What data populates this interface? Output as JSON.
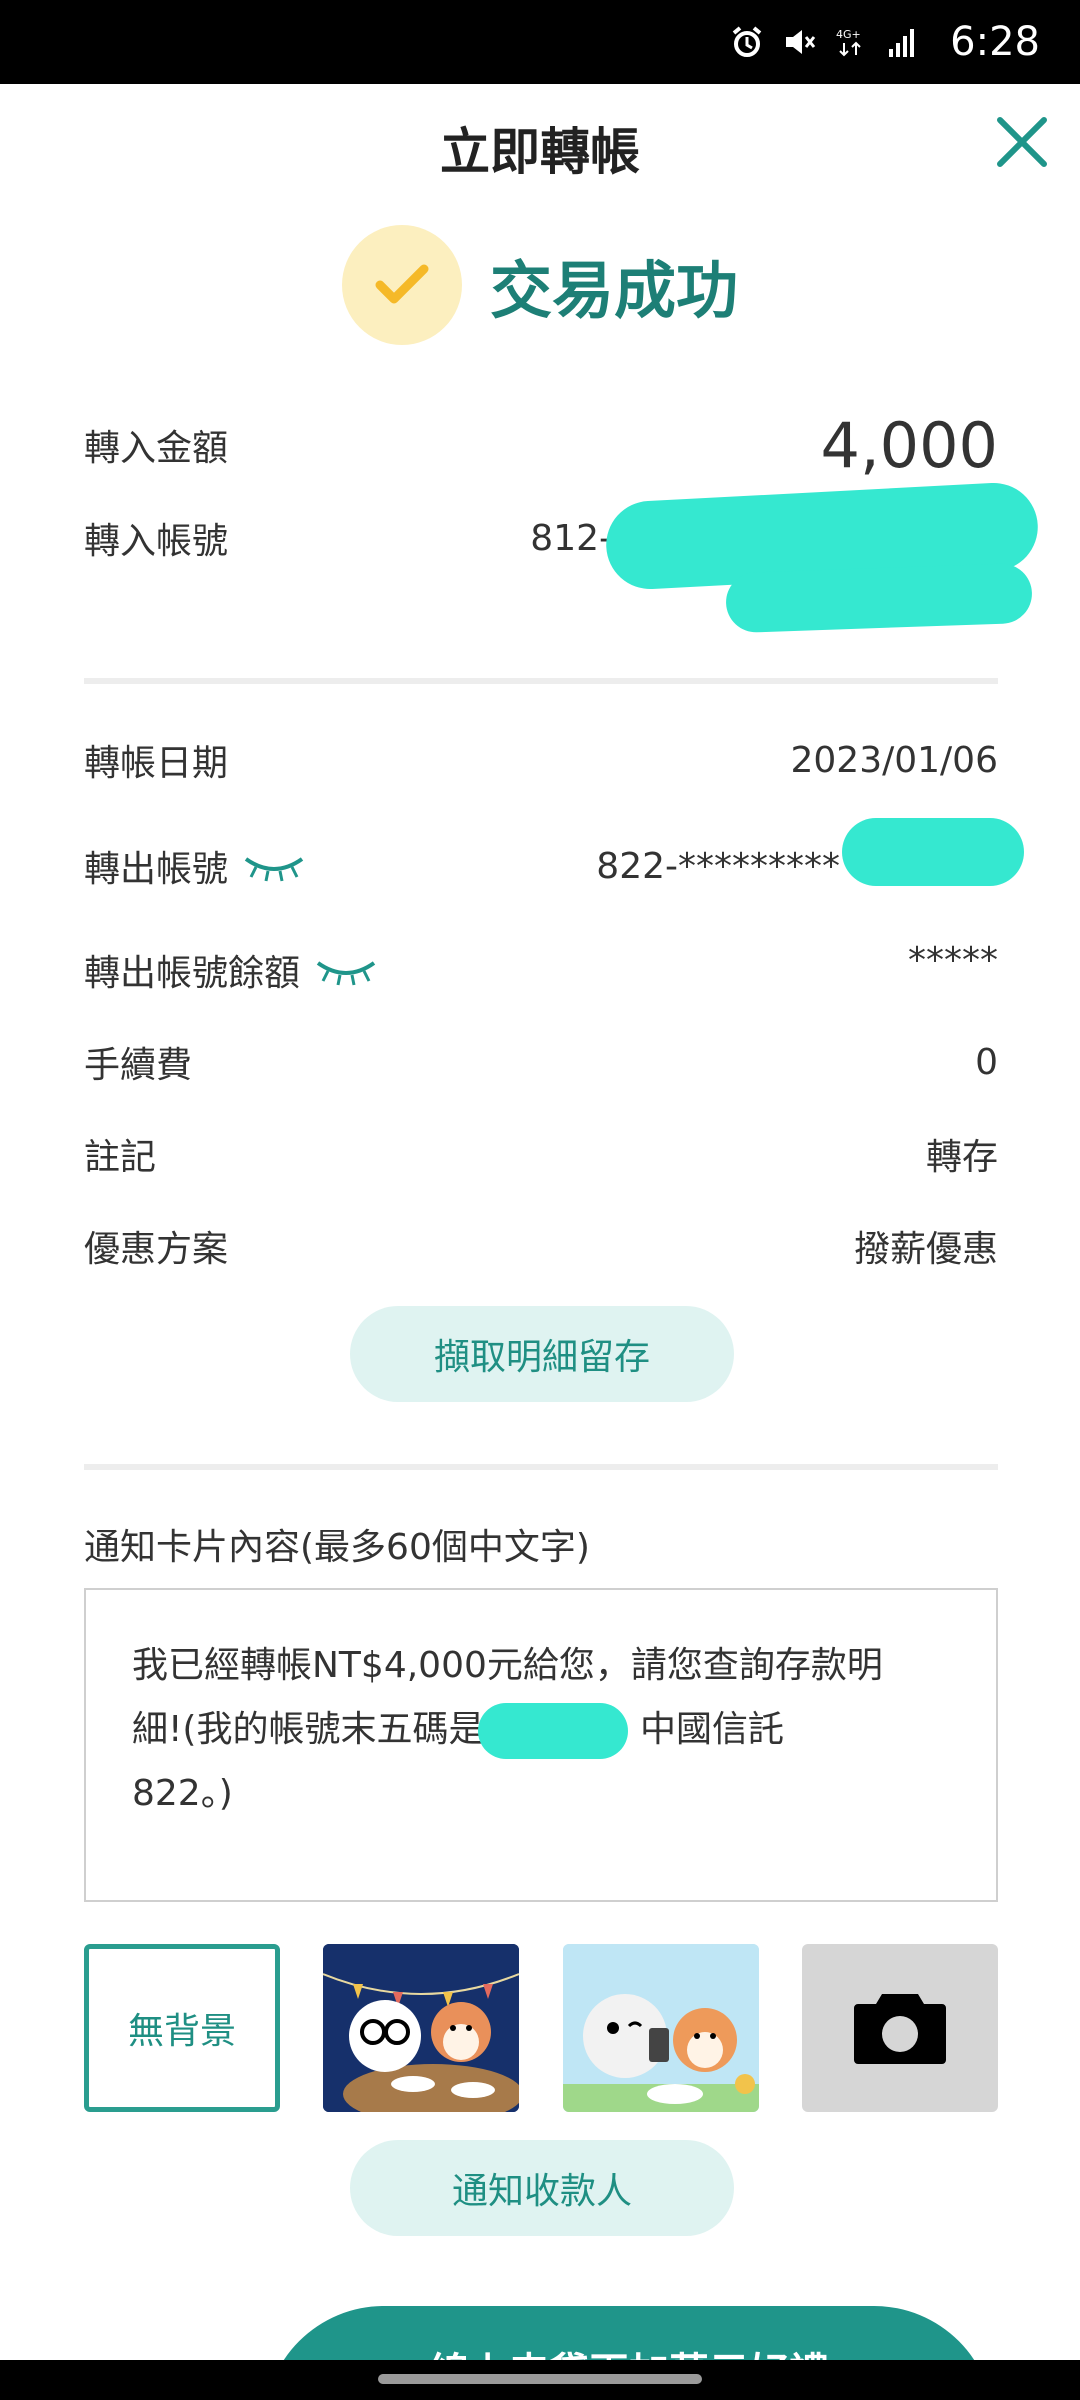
{
  "status_bar": {
    "time": "6:28",
    "icons": [
      "alarm-icon",
      "mute-icon",
      "network-4g-icon",
      "signal-icon"
    ],
    "network_label": "4G+"
  },
  "header": {
    "title": "立即轉帳",
    "close_icon": "close-icon"
  },
  "result": {
    "status_text": "交易成功",
    "icon": "check-icon"
  },
  "transfer_in": {
    "amount_label": "轉入金額",
    "amount_value": "4,000",
    "account_label": "轉入帳號",
    "account_value": "812-"
  },
  "details": {
    "date_label": "轉帳日期",
    "date_value": "2023/01/06",
    "from_account_label": "轉出帳號",
    "from_account_value": "822-*********",
    "balance_label": "轉出帳號餘額",
    "balance_value": "*****",
    "fee_label": "手續費",
    "fee_value": "0",
    "memo_label": "註記",
    "memo_value": "轉存",
    "promo_label": "優惠方案",
    "promo_value": "撥薪優惠"
  },
  "actions": {
    "save_details_label": "擷取明細留存",
    "notify_recipient_label": "通知收款人"
  },
  "notification": {
    "label": "通知卡片內容(最多60個中文字)",
    "message_line1": "我已經轉帳NT$4,000元給您，請您查詢存款明",
    "message_line2_start": "細!(我的帳號末五碼是",
    "message_line2_end": "中國信託",
    "message_line3": "822。)"
  },
  "backgrounds": {
    "none_label": "無背景",
    "options": [
      "none",
      "night-party-card",
      "day-phone-card",
      "camera"
    ]
  },
  "bottom_banner": {
    "text": "線上申貸再加萬元好禮"
  },
  "colors": {
    "accent": "#1f958a",
    "accent_text": "#1d7f76",
    "pill_bg": "#dff3f1",
    "success_circle": "#fcefbf",
    "check": "#f5b928",
    "redaction": "#35e8d0"
  }
}
